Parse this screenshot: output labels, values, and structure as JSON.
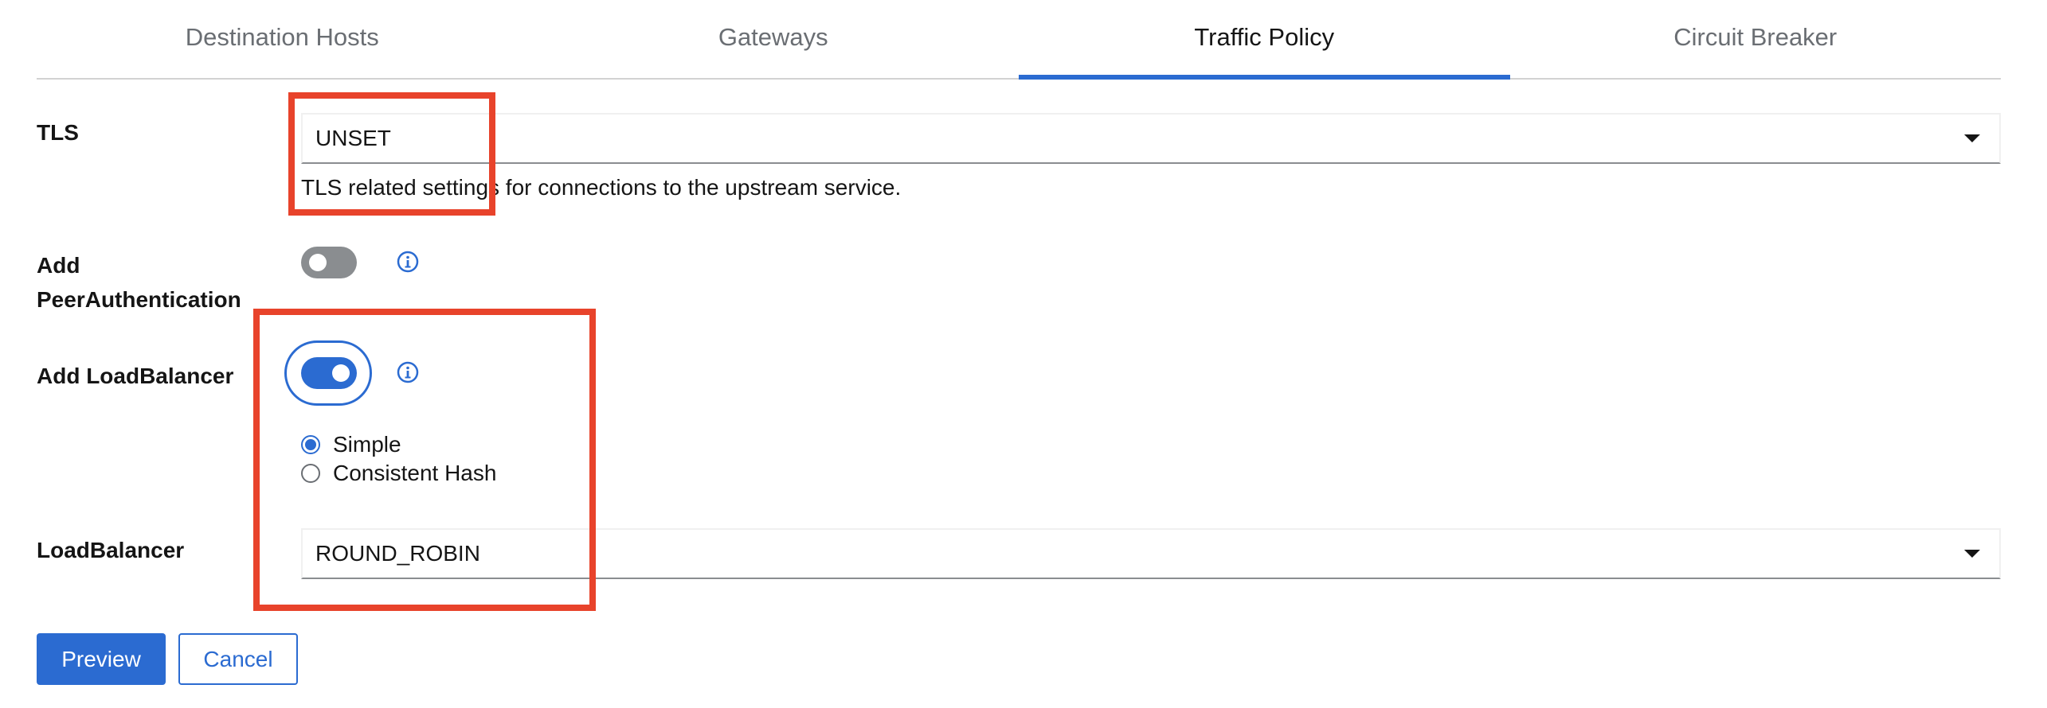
{
  "tabs": [
    {
      "label": "Destination Hosts",
      "active": false
    },
    {
      "label": "Gateways",
      "active": false
    },
    {
      "label": "Traffic Policy",
      "active": true
    },
    {
      "label": "Circuit Breaker",
      "active": false
    }
  ],
  "tls": {
    "label": "TLS",
    "value": "UNSET",
    "helper": "TLS related settings for connections to the upstream service."
  },
  "peer_auth": {
    "label_line1": "Add",
    "label_line2": "PeerAuthentication",
    "enabled": false
  },
  "load_balancer_toggle": {
    "label": "Add LoadBalancer",
    "enabled": true
  },
  "lb_mode": {
    "options": [
      "Simple",
      "Consistent Hash"
    ],
    "selected": "Simple"
  },
  "load_balancer": {
    "label": "LoadBalancer",
    "value": "ROUND_ROBIN"
  },
  "actions": {
    "preview_label": "Preview",
    "cancel_label": "Cancel"
  },
  "icons": {
    "info": "info-circle-icon",
    "dropdown": "caret-down-icon"
  },
  "colors": {
    "accent": "#2b6bd1",
    "annotation": "#e8432b",
    "toggle_off": "#8a8d90"
  }
}
